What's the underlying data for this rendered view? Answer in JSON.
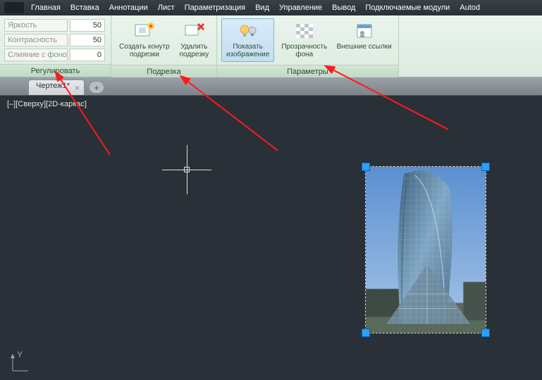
{
  "menu": {
    "items": [
      "Главная",
      "Вставка",
      "Аннотации",
      "Лист",
      "Параметризация",
      "Вид",
      "Управление",
      "Вывод",
      "Подключаемые модули",
      "Autod"
    ]
  },
  "ribbon": {
    "adjust": {
      "title": "Регулировать",
      "rows": [
        {
          "label": "Яркость",
          "value": "50"
        },
        {
          "label": "Контрасность",
          "value": "50"
        },
        {
          "label": "Слияние с фоном",
          "value": "0"
        }
      ]
    },
    "clip": {
      "title": "Подрезка",
      "buttons": [
        {
          "label1": "Создать конутр",
          "label2": "подрезки",
          "icon": "create-clip"
        },
        {
          "label1": "Удалить",
          "label2": "подрезку",
          "icon": "delete-clip"
        }
      ]
    },
    "options": {
      "title": "Параметры",
      "buttons": [
        {
          "label1": "Показать",
          "label2": "изображение",
          "icon": "show-image",
          "active": true
        },
        {
          "label1": "Прозрачность",
          "label2": "фона",
          "icon": "transparency"
        },
        {
          "label1": "Внешние ссылки",
          "label2": "",
          "icon": "xref"
        }
      ]
    }
  },
  "tabs": {
    "active": "Чертеж1*"
  },
  "view": {
    "label": "[–][Сверху][2D-каркас]",
    "ucs": "Y"
  }
}
